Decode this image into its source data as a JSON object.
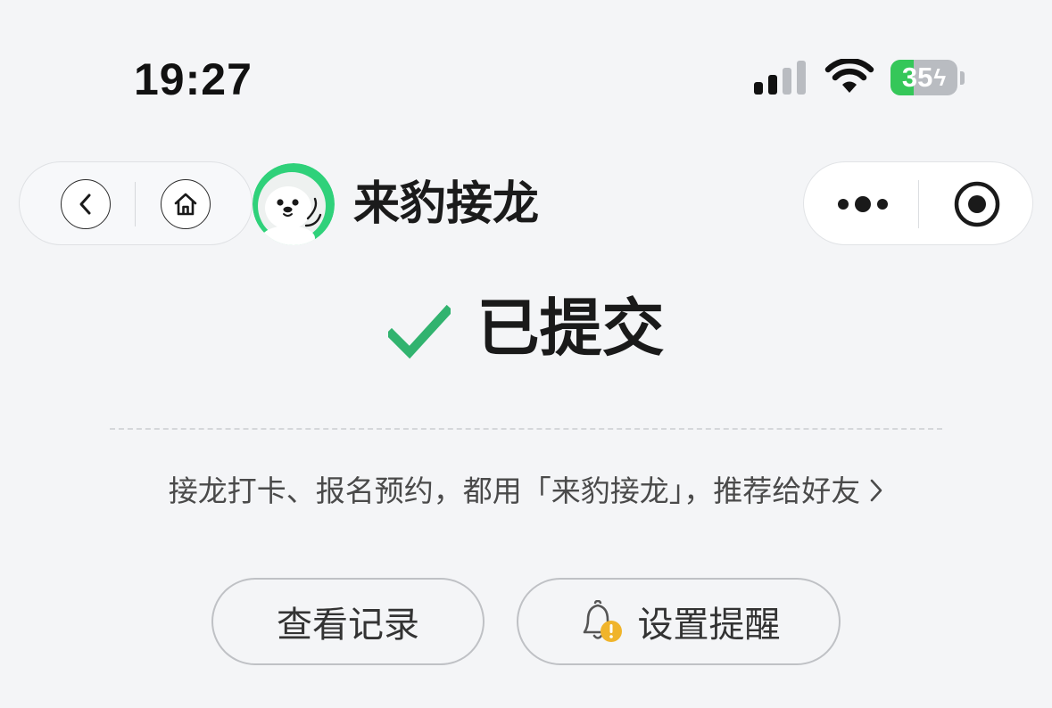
{
  "status_bar": {
    "time": "19:27",
    "battery_level": "35",
    "battery_fraction": 0.35,
    "battery_charging": true,
    "icons": [
      "signal-icon",
      "wifi-icon",
      "battery-icon"
    ]
  },
  "nav": {
    "back_icon": "chevron-left-icon",
    "home_icon": "home-icon"
  },
  "app": {
    "title": "来豹接龙",
    "logo_icon": "seal-mascot-logo",
    "accent_color": "#2fd17a"
  },
  "menu": {
    "more_icon": "more-dots-icon",
    "close_icon": "record-circle-icon"
  },
  "result": {
    "status_text": "已提交",
    "status_icon": "check-icon",
    "status_color": "#31b36f"
  },
  "recommend": {
    "text": "接龙打卡、报名预约，都用「来豹接龙」，推荐给好友",
    "icon": "chevron-right-icon"
  },
  "actions": {
    "view_records_label": "查看记录",
    "set_reminder_label": "设置提醒",
    "reminder_icon": "bell-warning-icon",
    "warning_color": "#f0b42b"
  }
}
